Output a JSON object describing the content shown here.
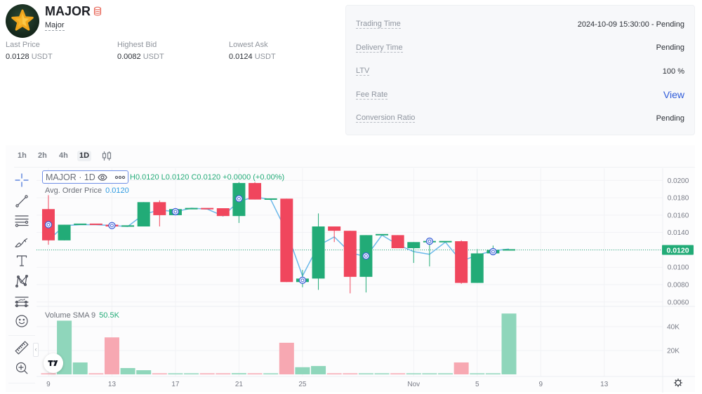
{
  "token": {
    "symbol": "MAJOR",
    "name": "Major",
    "logo_icon": "star-logo",
    "badge_icon": "coins-icon"
  },
  "stats": [
    {
      "label": "Last Price",
      "value": "0.0128",
      "unit": "USDT"
    },
    {
      "label": "Highest Bid",
      "value": "0.0082",
      "unit": "USDT"
    },
    {
      "label": "Lowest Ask",
      "value": "0.0124",
      "unit": "USDT"
    }
  ],
  "info_panel": {
    "rows": [
      {
        "label": "Trading Time",
        "value": "2024-10-09 15:30:00 - Pending"
      },
      {
        "label": "Delivery Time",
        "value": "Pending"
      },
      {
        "label": "LTV",
        "value": "100 %"
      },
      {
        "label": "Fee Rate",
        "value": "View"
      },
      {
        "label": "Conversion Ratio",
        "value": "Pending"
      }
    ]
  },
  "chart": {
    "intervals": [
      {
        "label": "1h",
        "active": false
      },
      {
        "label": "2h",
        "active": false
      },
      {
        "label": "4h",
        "active": false
      },
      {
        "label": "1D",
        "active": true
      }
    ],
    "chart_type_icon": "candles-icon",
    "tools": [
      "crosshair-icon",
      "trend-line-icon",
      "fib-retracement-icon",
      "brush-icon",
      "text-icon",
      "pattern-icon",
      "prediction-icon",
      "emoji-icon",
      "ruler-icon",
      "zoom-in-icon"
    ],
    "legend": {
      "symbol": "MAJOR · 1D",
      "high": "H0.0120",
      "low": "L0.0120",
      "close": "C0.0120",
      "change": "+0.0000 (+0.00%)"
    },
    "avg_order_price": {
      "label": "Avg. Order Price",
      "value": "0.0120"
    },
    "volume_legend": {
      "label": "Volume SMA 9",
      "value": "50.5K"
    },
    "current_price_label": "0.0120",
    "collapse_label": "‹"
  },
  "colors": {
    "up": "#22ab77",
    "down": "#f0465d",
    "up_volume": "#8fd6bb",
    "down_volume": "#f7a8b2",
    "line": "#6ab8ea",
    "marker": "#3d62d8",
    "link": "#2f5bd9"
  },
  "chart_data": {
    "type": "candlestick",
    "title": "MAJOR · 1D",
    "grid": true,
    "dates": [
      "Oct 9",
      "Oct 10",
      "Oct 11",
      "Oct 12",
      "Oct 13",
      "Oct 14",
      "Oct 15",
      "Oct 16",
      "Oct 17",
      "Oct 18",
      "Oct 19",
      "Oct 20",
      "Oct 21",
      "Oct 22",
      "Oct 23",
      "Oct 24",
      "Oct 25",
      "Oct 26",
      "Oct 27",
      "Oct 28",
      "Oct 29",
      "Oct 30",
      "Oct 31",
      "Nov 1",
      "Nov 2",
      "Nov 3",
      "Nov 4",
      "Nov 5",
      "Nov 6",
      "Nov 7"
    ],
    "ohlc_order": [
      "open",
      "high",
      "low",
      "close"
    ],
    "ohlc": [
      [
        0.0167,
        0.0183,
        0.0126,
        0.0131
      ],
      [
        0.0131,
        0.0149,
        0.0131,
        0.0149
      ],
      [
        0.0149,
        0.015,
        0.0149,
        0.015
      ],
      [
        0.015,
        0.015,
        0.0149,
        0.0149
      ],
      [
        0.0149,
        0.0149,
        0.0147,
        0.0147
      ],
      [
        0.0147,
        0.0148,
        0.0147,
        0.0148
      ],
      [
        0.0147,
        0.0175,
        0.0147,
        0.0175
      ],
      [
        0.0175,
        0.0177,
        0.0147,
        0.016
      ],
      [
        0.016,
        0.0167,
        0.016,
        0.0167
      ],
      [
        0.0167,
        0.0168,
        0.0167,
        0.0168
      ],
      [
        0.0168,
        0.0168,
        0.0167,
        0.0167
      ],
      [
        0.0168,
        0.0168,
        0.0159,
        0.0159
      ],
      [
        0.0159,
        0.0198,
        0.0151,
        0.0197
      ],
      [
        0.0197,
        0.0198,
        0.0178,
        0.0178
      ],
      [
        0.0178,
        0.0179,
        0.0178,
        0.0179
      ],
      [
        0.0179,
        0.0179,
        0.0083,
        0.0083
      ],
      [
        0.0083,
        0.0097,
        0.0077,
        0.0087
      ],
      [
        0.0087,
        0.0162,
        0.0074,
        0.0147
      ],
      [
        0.0147,
        0.0147,
        0.0129,
        0.0142
      ],
      [
        0.0142,
        0.0142,
        0.007,
        0.0089
      ],
      [
        0.0089,
        0.0137,
        0.0071,
        0.0137
      ],
      [
        0.0137,
        0.0138,
        0.0137,
        0.0138
      ],
      [
        0.0137,
        0.0137,
        0.0122,
        0.0122
      ],
      [
        0.0122,
        0.0129,
        0.0105,
        0.0129
      ],
      [
        0.0129,
        0.013,
        0.0101,
        0.013
      ],
      [
        0.0129,
        0.013,
        0.0129,
        0.013
      ],
      [
        0.013,
        0.0131,
        0.0081,
        0.0082
      ],
      [
        0.0082,
        0.0121,
        0.0082,
        0.0116
      ],
      [
        0.0116,
        0.0125,
        0.0116,
        0.012
      ],
      [
        0.012,
        0.012,
        0.012,
        0.012
      ]
    ],
    "line": {
      "name": "price line",
      "values": [
        0.0131,
        0.0148,
        0.0149,
        0.0149,
        0.0148,
        0.0147,
        0.0161,
        0.0166,
        0.0164,
        0.0168,
        0.0167,
        0.0159,
        0.0176,
        0.0181,
        0.0178,
        0.0141,
        0.009,
        0.0125,
        0.0135,
        0.0117,
        0.0112,
        0.0137,
        0.0126,
        0.0118,
        0.0115,
        0.0129,
        0.0107,
        0.0114,
        0.0119,
        0.0121
      ]
    },
    "markers": [
      {
        "index": 0,
        "date": "Oct 9",
        "price": 0.0149
      },
      {
        "index": 4,
        "date": "Oct 13",
        "price": 0.0148
      },
      {
        "index": 8,
        "date": "Oct 17",
        "price": 0.0164
      },
      {
        "index": 12,
        "date": "Oct 21",
        "price": 0.0179
      },
      {
        "index": 16,
        "date": "Oct 25",
        "price": 0.0085
      },
      {
        "index": 20,
        "date": "Oct 29",
        "price": 0.0113
      },
      {
        "index": 24,
        "date": "Nov 2",
        "price": 0.013
      },
      {
        "index": 28,
        "date": "Nov 6",
        "price": 0.0118
      }
    ],
    "volume": {
      "name": "Volume SMA 9",
      "unit": "K",
      "values_k": [
        0.3,
        45,
        10,
        0.3,
        31,
        5.3,
        3.5,
        0.3,
        0.3,
        0.3,
        0.3,
        0.3,
        1.0,
        0.3,
        0.3,
        26.5,
        6,
        7,
        0.3,
        0.3,
        0.3,
        0.3,
        0.3,
        0.3,
        0.3,
        0.3,
        10,
        0.3,
        0.3,
        51
      ],
      "range": [
        0,
        57
      ],
      "ticks": [
        {
          "value": 40,
          "label": "40K"
        },
        {
          "value": 20,
          "label": "20K"
        }
      ]
    },
    "y_range": [
      0.0055,
      0.0214
    ],
    "y_ticks": [
      {
        "value": 0.02,
        "label": "0.0200"
      },
      {
        "value": 0.018,
        "label": "0.0180"
      },
      {
        "value": 0.016,
        "label": "0.0160"
      },
      {
        "value": 0.014,
        "label": "0.0140"
      },
      {
        "value": 0.012,
        "label": "0.0120"
      },
      {
        "value": 0.01,
        "label": "0.0100"
      },
      {
        "value": 0.008,
        "label": "0.0080"
      },
      {
        "value": 0.006,
        "label": "0.0060"
      }
    ],
    "x_range_index": [
      -0.75,
      38.68
    ],
    "x_ticks": [
      {
        "index": 0,
        "label": "9"
      },
      {
        "index": 4,
        "label": "13"
      },
      {
        "index": 8,
        "label": "17"
      },
      {
        "index": 12,
        "label": "21"
      },
      {
        "index": 16,
        "label": "25"
      },
      {
        "index": 23,
        "label": "Nov"
      },
      {
        "index": 27,
        "label": "5"
      },
      {
        "index": 31,
        "label": "9"
      },
      {
        "index": 35,
        "label": "13"
      }
    ],
    "current_price": 0.012
  }
}
